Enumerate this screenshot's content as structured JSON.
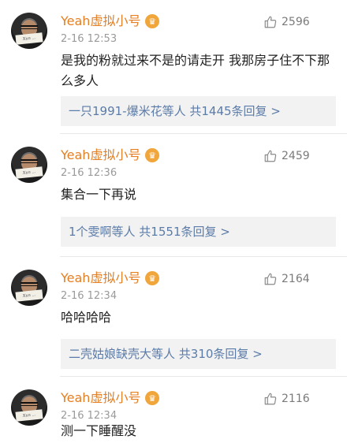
{
  "comments": [
    {
      "username": "Yeah虚拟小号",
      "time": "2-16 12:53",
      "likes": "2596",
      "text": "是我的粉就过来不是的请走开 我那房子住不下那么多人",
      "reply_summary": "一只1991-爆米花等人  共1445条回复 >"
    },
    {
      "username": "Yeah虚拟小号",
      "time": "2-16 12:36",
      "likes": "2459",
      "text": "集合一下再说",
      "reply_summary": "1个雯啊等人  共1551条回复 >"
    },
    {
      "username": "Yeah虚拟小号",
      "time": "2-16 12:34",
      "likes": "2164",
      "text": "哈哈哈哈",
      "reply_summary": "二壳姑娘缺壳大等人  共310条回复 >"
    },
    {
      "username": "Yeah虚拟小号",
      "time": "2-16 12:34",
      "likes": "2116",
      "text": "测一下睡醒没"
    }
  ],
  "icons": {
    "like": "thumbs-up-icon",
    "vip": "crown-badge-icon"
  },
  "colors": {
    "username": "#e47f25",
    "reply_link": "#5b7ba8",
    "reply_bg": "#f2f2f2",
    "vip_badge": "#f0a63b"
  }
}
